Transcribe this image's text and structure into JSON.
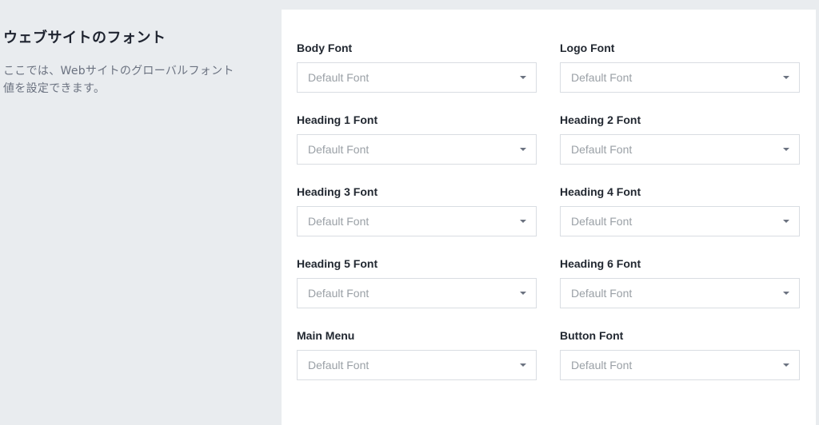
{
  "section": {
    "title": "ウェブサイトのフォント",
    "description": "ここでは、Webサイトのグローバルフォント値を設定できます。"
  },
  "fields": [
    {
      "label": "Body Font",
      "value": "Default Font"
    },
    {
      "label": "Logo Font",
      "value": "Default Font"
    },
    {
      "label": "Heading 1 Font",
      "value": "Default Font"
    },
    {
      "label": "Heading 2 Font",
      "value": "Default Font"
    },
    {
      "label": "Heading 3 Font",
      "value": "Default Font"
    },
    {
      "label": "Heading 4 Font",
      "value": "Default Font"
    },
    {
      "label": "Heading 5 Font",
      "value": "Default Font"
    },
    {
      "label": "Heading 6 Font",
      "value": "Default Font"
    },
    {
      "label": "Main Menu",
      "value": "Default Font"
    },
    {
      "label": "Button Font",
      "value": "Default Font"
    }
  ],
  "icons": {
    "dropdown": "chevron-down-icon"
  }
}
